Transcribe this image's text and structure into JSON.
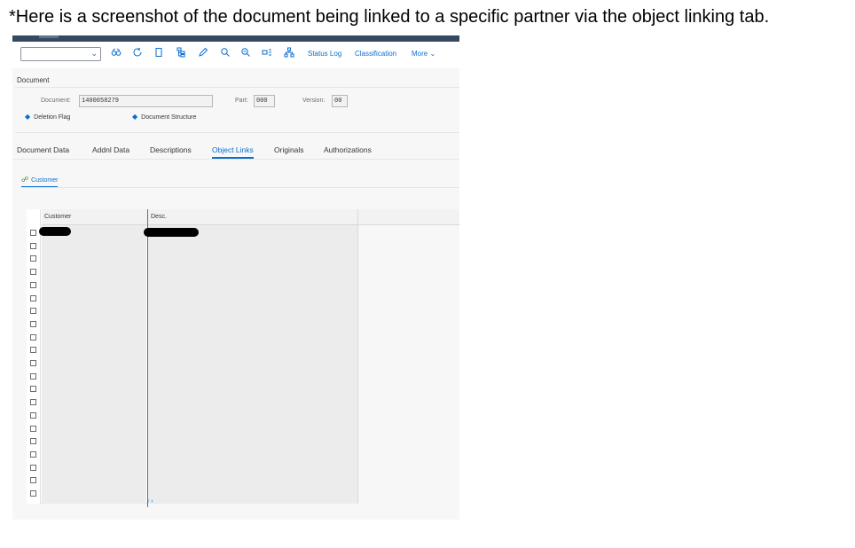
{
  "caption": "*Here is a screenshot of the document being linked to a specific partner via the object linking tab.",
  "toolbar": {
    "command_value": "",
    "icons": [
      "glasses-icon",
      "refresh-icon",
      "copy-icon",
      "tree-icon",
      "edit-icon",
      "search-icon",
      "search-next-icon",
      "layout-icon",
      "hierarchy-icon"
    ],
    "status_log": "Status Log",
    "classification": "Classification",
    "more": "More"
  },
  "header": {
    "section_title": "Document",
    "document_label": "Document:",
    "document_value": "1400058279",
    "part_label": "Part:",
    "part_value": "000",
    "version_label": "Version:",
    "version_value": "00",
    "deletion_flag": "Deletion Flag",
    "document_structure": "Document Structure"
  },
  "tabs": [
    "Document Data",
    "Addnl Data",
    "Descriptions",
    "Object Links",
    "Originals",
    "Authorizations"
  ],
  "active_tab": "Object Links",
  "subtab": "Customer",
  "table": {
    "columns": [
      "Customer",
      "Desc."
    ],
    "row_count": 21,
    "first_row_redacted": true
  },
  "colors": {
    "accent": "#0a6ed1",
    "shell": "#354a5f"
  }
}
